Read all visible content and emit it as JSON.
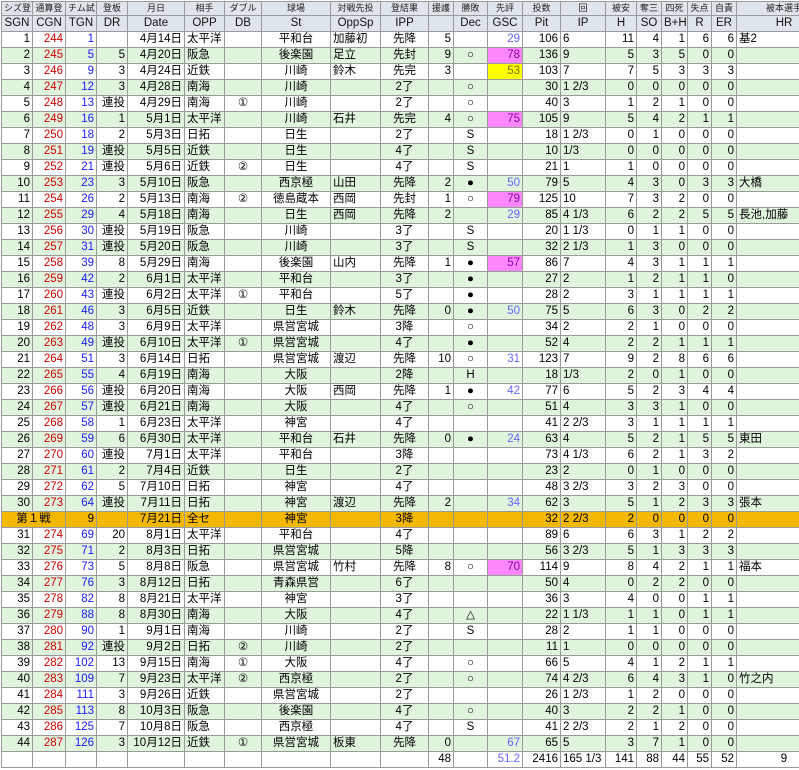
{
  "header": {
    "jp": [
      "シズ登",
      "通算登",
      "チム試",
      "登板",
      "月日",
      "相手",
      "ダブル",
      "球場",
      "対戦先投",
      "登結果",
      "援護",
      "勝敗",
      "先評",
      "投数",
      "回",
      "被安",
      "奪三",
      "四死",
      "失点",
      "自責",
      "被本選手"
    ],
    "en": [
      "SGN",
      "CGN",
      "TGN",
      "DR",
      "Date",
      "OPP",
      "DB",
      "St",
      "OppSp",
      "IPP",
      "",
      "Dec",
      "GSC",
      "Pit",
      "IP",
      "H",
      "SO",
      "B+H",
      "R",
      "ER",
      "HR"
    ]
  },
  "highlight_color": "#f5b800",
  "rows": [
    {
      "sgn": "1",
      "cgn": "244",
      "tgn": "1",
      "dr": "",
      "date": "4月14日",
      "opp": "太平洋",
      "db": "",
      "st": "平和台",
      "oppsp": "加藤初",
      "ipp": "先降",
      "run": "5",
      "dec": "",
      "gsc": "29",
      "gsc_color": "",
      "pit": "106",
      "ip": "6",
      "h": "11",
      "so": "4",
      "bh": "1",
      "r": "6",
      "er": "6",
      "hr": "基2"
    },
    {
      "sgn": "2",
      "cgn": "245",
      "tgn": "5",
      "dr": "5",
      "date": "4月20日",
      "opp": "阪急",
      "db": "",
      "st": "後楽園",
      "oppsp": "足立",
      "ipp": "先封",
      "run": "9",
      "dec": "○",
      "gsc": "78",
      "gsc_color": "pink",
      "pit": "136",
      "ip": "9",
      "h": "5",
      "so": "3",
      "bh": "5",
      "r": "0",
      "er": "0",
      "hr": ""
    },
    {
      "sgn": "3",
      "cgn": "246",
      "tgn": "9",
      "dr": "3",
      "date": "4月24日",
      "opp": "近鉄",
      "db": "",
      "st": "川崎",
      "oppsp": "鈴木",
      "ipp": "先完",
      "run": "3",
      "dec": "",
      "gsc": "53",
      "gsc_color": "yellow",
      "pit": "103",
      "ip": "7",
      "h": "7",
      "so": "5",
      "bh": "3",
      "r": "3",
      "er": "3",
      "hr": ""
    },
    {
      "sgn": "4",
      "cgn": "247",
      "tgn": "12",
      "dr": "3",
      "date": "4月28日",
      "opp": "南海",
      "db": "",
      "st": "川崎",
      "oppsp": "",
      "ipp": "2了",
      "run": "",
      "dec": "○",
      "gsc": "",
      "gsc_color": "",
      "pit": "30",
      "ip": "1 2/3",
      "h": "0",
      "so": "0",
      "bh": "0",
      "r": "0",
      "er": "0",
      "hr": ""
    },
    {
      "sgn": "5",
      "cgn": "248",
      "tgn": "13",
      "dr": "連投",
      "date": "4月29日",
      "opp": "南海",
      "db": "①",
      "st": "川崎",
      "oppsp": "",
      "ipp": "2了",
      "run": "",
      "dec": "○",
      "gsc": "",
      "gsc_color": "",
      "pit": "40",
      "ip": "3",
      "h": "1",
      "so": "2",
      "bh": "1",
      "r": "0",
      "er": "0",
      "hr": ""
    },
    {
      "sgn": "6",
      "cgn": "249",
      "tgn": "16",
      "dr": "1",
      "date": "5月1日",
      "opp": "太平洋",
      "db": "",
      "st": "川崎",
      "oppsp": "石井",
      "ipp": "先完",
      "run": "4",
      "dec": "○",
      "gsc": "75",
      "gsc_color": "pink",
      "pit": "105",
      "ip": "9",
      "h": "5",
      "so": "4",
      "bh": "2",
      "r": "1",
      "er": "1",
      "hr": ""
    },
    {
      "sgn": "7",
      "cgn": "250",
      "tgn": "18",
      "dr": "2",
      "date": "5月3日",
      "opp": "日拓",
      "db": "",
      "st": "日生",
      "oppsp": "",
      "ipp": "2了",
      "run": "",
      "dec": "S",
      "gsc": "",
      "gsc_color": "",
      "pit": "18",
      "ip": "1 2/3",
      "h": "0",
      "so": "1",
      "bh": "0",
      "r": "0",
      "er": "0",
      "hr": ""
    },
    {
      "sgn": "8",
      "cgn": "251",
      "tgn": "19",
      "dr": "連投",
      "date": "5月5日",
      "opp": "近鉄",
      "db": "",
      "st": "日生",
      "oppsp": "",
      "ipp": "4了",
      "run": "",
      "dec": "S",
      "gsc": "",
      "gsc_color": "",
      "pit": "10",
      "ip": "1/3",
      "h": "0",
      "so": "0",
      "bh": "0",
      "r": "0",
      "er": "0",
      "hr": ""
    },
    {
      "sgn": "9",
      "cgn": "252",
      "tgn": "21",
      "dr": "連投",
      "date": "5月6日",
      "opp": "近鉄",
      "db": "②",
      "st": "日生",
      "oppsp": "",
      "ipp": "4了",
      "run": "",
      "dec": "S",
      "gsc": "",
      "gsc_color": "",
      "pit": "21",
      "ip": "1",
      "h": "1",
      "so": "0",
      "bh": "0",
      "r": "0",
      "er": "0",
      "hr": ""
    },
    {
      "sgn": "10",
      "cgn": "253",
      "tgn": "23",
      "dr": "3",
      "date": "5月10日",
      "opp": "阪急",
      "db": "",
      "st": "西京極",
      "oppsp": "山田",
      "ipp": "先降",
      "run": "2",
      "dec": "●",
      "gsc": "50",
      "gsc_color": "",
      "pit": "79",
      "ip": "5",
      "h": "4",
      "so": "3",
      "bh": "0",
      "r": "3",
      "er": "3",
      "hr": "大橋"
    },
    {
      "sgn": "11",
      "cgn": "254",
      "tgn": "26",
      "dr": "2",
      "date": "5月13日",
      "opp": "南海",
      "db": "②",
      "st": "徳島蔵本",
      "oppsp": "西岡",
      "ipp": "先封",
      "run": "1",
      "dec": "○",
      "gsc": "79",
      "gsc_color": "pink",
      "pit": "125",
      "ip": "10",
      "h": "7",
      "so": "3",
      "bh": "2",
      "r": "0",
      "er": "0",
      "hr": ""
    },
    {
      "sgn": "12",
      "cgn": "255",
      "tgn": "29",
      "dr": "4",
      "date": "5月18日",
      "opp": "南海",
      "db": "",
      "st": "日生",
      "oppsp": "西岡",
      "ipp": "先降",
      "run": "2",
      "dec": "",
      "gsc": "29",
      "gsc_color": "",
      "pit": "85",
      "ip": "4 1/3",
      "h": "6",
      "so": "2",
      "bh": "2",
      "r": "5",
      "er": "5",
      "hr": "長池,加藤"
    },
    {
      "sgn": "13",
      "cgn": "256",
      "tgn": "30",
      "dr": "連投",
      "date": "5月19日",
      "opp": "阪急",
      "db": "",
      "st": "川崎",
      "oppsp": "",
      "ipp": "3了",
      "run": "",
      "dec": "S",
      "gsc": "",
      "gsc_color": "",
      "pit": "20",
      "ip": "1 1/3",
      "h": "0",
      "so": "1",
      "bh": "1",
      "r": "0",
      "er": "0",
      "hr": ""
    },
    {
      "sgn": "14",
      "cgn": "257",
      "tgn": "31",
      "dr": "連投",
      "date": "5月20日",
      "opp": "阪急",
      "db": "",
      "st": "川崎",
      "oppsp": "",
      "ipp": "3了",
      "run": "",
      "dec": "S",
      "gsc": "",
      "gsc_color": "",
      "pit": "32",
      "ip": "2 1/3",
      "h": "1",
      "so": "3",
      "bh": "0",
      "r": "0",
      "er": "0",
      "hr": ""
    },
    {
      "sgn": "15",
      "cgn": "258",
      "tgn": "39",
      "dr": "8",
      "date": "5月29日",
      "opp": "南海",
      "db": "",
      "st": "後楽園",
      "oppsp": "山内",
      "ipp": "先降",
      "run": "1",
      "dec": "●",
      "gsc": "57",
      "gsc_color": "pink",
      "pit": "86",
      "ip": "7",
      "h": "4",
      "so": "3",
      "bh": "1",
      "r": "1",
      "er": "1",
      "hr": ""
    },
    {
      "sgn": "16",
      "cgn": "259",
      "tgn": "42",
      "dr": "2",
      "date": "6月1日",
      "opp": "太平洋",
      "db": "",
      "st": "平和台",
      "oppsp": "",
      "ipp": "3了",
      "run": "",
      "dec": "●",
      "gsc": "",
      "gsc_color": "",
      "pit": "27",
      "ip": "2",
      "h": "1",
      "so": "2",
      "bh": "1",
      "r": "1",
      "er": "0",
      "hr": ""
    },
    {
      "sgn": "17",
      "cgn": "260",
      "tgn": "43",
      "dr": "連投",
      "date": "6月2日",
      "opp": "太平洋",
      "db": "①",
      "st": "平和台",
      "oppsp": "",
      "ipp": "5了",
      "run": "",
      "dec": "●",
      "gsc": "",
      "gsc_color": "",
      "pit": "28",
      "ip": "2",
      "h": "3",
      "so": "1",
      "bh": "1",
      "r": "1",
      "er": "1",
      "hr": ""
    },
    {
      "sgn": "18",
      "cgn": "261",
      "tgn": "46",
      "dr": "3",
      "date": "6月5日",
      "opp": "近鉄",
      "db": "",
      "st": "日生",
      "oppsp": "鈴木",
      "ipp": "先降",
      "run": "0",
      "dec": "●",
      "gsc": "50",
      "gsc_color": "",
      "pit": "75",
      "ip": "5",
      "h": "6",
      "so": "3",
      "bh": "0",
      "r": "2",
      "er": "2",
      "hr": ""
    },
    {
      "sgn": "19",
      "cgn": "262",
      "tgn": "48",
      "dr": "3",
      "date": "6月9日",
      "opp": "太平洋",
      "db": "",
      "st": "県営宮城",
      "oppsp": "",
      "ipp": "3降",
      "run": "",
      "dec": "○",
      "gsc": "",
      "gsc_color": "",
      "pit": "34",
      "ip": "2",
      "h": "2",
      "so": "1",
      "bh": "0",
      "r": "0",
      "er": "0",
      "hr": ""
    },
    {
      "sgn": "20",
      "cgn": "263",
      "tgn": "49",
      "dr": "連投",
      "date": "6月10日",
      "opp": "太平洋",
      "db": "①",
      "st": "県営宮城",
      "oppsp": "",
      "ipp": "4了",
      "run": "",
      "dec": "●",
      "gsc": "",
      "gsc_color": "",
      "pit": "52",
      "ip": "4",
      "h": "2",
      "so": "2",
      "bh": "1",
      "r": "1",
      "er": "1",
      "hr": ""
    },
    {
      "sgn": "21",
      "cgn": "264",
      "tgn": "51",
      "dr": "3",
      "date": "6月14日",
      "opp": "日拓",
      "db": "",
      "st": "県営宮城",
      "oppsp": "渡辺",
      "ipp": "先降",
      "run": "10",
      "dec": "○",
      "gsc": "31",
      "gsc_color": "",
      "pit": "123",
      "ip": "7",
      "h": "9",
      "so": "2",
      "bh": "8",
      "r": "6",
      "er": "6",
      "hr": ""
    },
    {
      "sgn": "22",
      "cgn": "265",
      "tgn": "55",
      "dr": "4",
      "date": "6月19日",
      "opp": "南海",
      "db": "",
      "st": "大阪",
      "oppsp": "",
      "ipp": "2降",
      "run": "",
      "dec": "H",
      "gsc": "",
      "gsc_color": "",
      "pit": "18",
      "ip": "1/3",
      "h": "2",
      "so": "0",
      "bh": "1",
      "r": "0",
      "er": "0",
      "hr": ""
    },
    {
      "sgn": "23",
      "cgn": "266",
      "tgn": "56",
      "dr": "連投",
      "date": "6月20日",
      "opp": "南海",
      "db": "",
      "st": "大阪",
      "oppsp": "西岡",
      "ipp": "先降",
      "run": "1",
      "dec": "●",
      "gsc": "42",
      "gsc_color": "",
      "pit": "77",
      "ip": "6",
      "h": "5",
      "so": "2",
      "bh": "3",
      "r": "4",
      "er": "4",
      "hr": ""
    },
    {
      "sgn": "24",
      "cgn": "267",
      "tgn": "57",
      "dr": "連投",
      "date": "6月21日",
      "opp": "南海",
      "db": "",
      "st": "大阪",
      "oppsp": "",
      "ipp": "4了",
      "run": "",
      "dec": "○",
      "gsc": "",
      "gsc_color": "",
      "pit": "51",
      "ip": "4",
      "h": "3",
      "so": "3",
      "bh": "1",
      "r": "0",
      "er": "0",
      "hr": ""
    },
    {
      "sgn": "25",
      "cgn": "268",
      "tgn": "58",
      "dr": "1",
      "date": "6月23日",
      "opp": "太平洋",
      "db": "",
      "st": "神宮",
      "oppsp": "",
      "ipp": "4了",
      "run": "",
      "dec": "",
      "gsc": "",
      "gsc_color": "",
      "pit": "41",
      "ip": "2 2/3",
      "h": "3",
      "so": "1",
      "bh": "1",
      "r": "1",
      "er": "1",
      "hr": ""
    },
    {
      "sgn": "26",
      "cgn": "269",
      "tgn": "59",
      "dr": "6",
      "date": "6月30日",
      "opp": "太平洋",
      "db": "",
      "st": "平和台",
      "oppsp": "石井",
      "ipp": "先降",
      "run": "0",
      "dec": "●",
      "gsc": "24",
      "gsc_color": "",
      "pit": "63",
      "ip": "4",
      "h": "5",
      "so": "2",
      "bh": "1",
      "r": "5",
      "er": "5",
      "hr": "東田"
    },
    {
      "sgn": "27",
      "cgn": "270",
      "tgn": "60",
      "dr": "連投",
      "date": "7月1日",
      "opp": "太平洋",
      "db": "",
      "st": "平和台",
      "oppsp": "",
      "ipp": "3降",
      "run": "",
      "dec": "",
      "gsc": "",
      "gsc_color": "",
      "pit": "73",
      "ip": "4 1/3",
      "h": "6",
      "so": "2",
      "bh": "1",
      "r": "3",
      "er": "2",
      "hr": ""
    },
    {
      "sgn": "28",
      "cgn": "271",
      "tgn": "61",
      "dr": "2",
      "date": "7月4日",
      "opp": "近鉄",
      "db": "",
      "st": "日生",
      "oppsp": "",
      "ipp": "2了",
      "run": "",
      "dec": "",
      "gsc": "",
      "gsc_color": "",
      "pit": "23",
      "ip": "2",
      "h": "0",
      "so": "1",
      "bh": "0",
      "r": "0",
      "er": "0",
      "hr": ""
    },
    {
      "sgn": "29",
      "cgn": "272",
      "tgn": "62",
      "dr": "5",
      "date": "7月10日",
      "opp": "日拓",
      "db": "",
      "st": "神宮",
      "oppsp": "",
      "ipp": "4了",
      "run": "",
      "dec": "",
      "gsc": "",
      "gsc_color": "",
      "pit": "48",
      "ip": "3 2/3",
      "h": "3",
      "so": "2",
      "bh": "3",
      "r": "0",
      "er": "0",
      "hr": ""
    },
    {
      "sgn": "30",
      "cgn": "273",
      "tgn": "64",
      "dr": "連投",
      "date": "7月11日",
      "opp": "日拓",
      "db": "",
      "st": "神宮",
      "oppsp": "渡辺",
      "ipp": "先降",
      "run": "2",
      "dec": "",
      "gsc": "34",
      "gsc_color": "",
      "pit": "62",
      "ip": "3",
      "h": "5",
      "so": "1",
      "bh": "2",
      "r": "3",
      "er": "3",
      "hr": "張本"
    },
    {
      "highlight": true,
      "label": "第１戦",
      "tgn": "9",
      "date": "7月21日",
      "opp": "全セ",
      "st": "神宮",
      "ipp": "3降",
      "pit": "32",
      "ip": "2 2/3",
      "h": "2",
      "so": "0",
      "bh": "0",
      "r": "0",
      "er": "0"
    },
    {
      "sgn": "31",
      "cgn": "274",
      "tgn": "69",
      "dr": "20",
      "date": "8月1日",
      "opp": "太平洋",
      "db": "",
      "st": "平和台",
      "oppsp": "",
      "ipp": "4了",
      "run": "",
      "dec": "",
      "gsc": "",
      "gsc_color": "",
      "pit": "89",
      "ip": "6",
      "h": "6",
      "so": "3",
      "bh": "1",
      "r": "2",
      "er": "2",
      "hr": ""
    },
    {
      "sgn": "32",
      "cgn": "275",
      "tgn": "71",
      "dr": "2",
      "date": "8月3日",
      "opp": "日拓",
      "db": "",
      "st": "県営宮城",
      "oppsp": "",
      "ipp": "5降",
      "run": "",
      "dec": "",
      "gsc": "",
      "gsc_color": "",
      "pit": "56",
      "ip": "3 2/3",
      "h": "5",
      "so": "1",
      "bh": "3",
      "r": "3",
      "er": "3",
      "hr": ""
    },
    {
      "sgn": "33",
      "cgn": "276",
      "tgn": "73",
      "dr": "5",
      "date": "8月8日",
      "opp": "阪急",
      "db": "",
      "st": "県営宮城",
      "oppsp": "竹村",
      "ipp": "先降",
      "run": "8",
      "dec": "○",
      "gsc": "70",
      "gsc_color": "pink",
      "pit": "114",
      "ip": "9",
      "h": "8",
      "so": "4",
      "bh": "2",
      "r": "1",
      "er": "1",
      "hr": "福本"
    },
    {
      "sgn": "34",
      "cgn": "277",
      "tgn": "76",
      "dr": "3",
      "date": "8月12日",
      "opp": "日拓",
      "db": "",
      "st": "青森県営",
      "oppsp": "",
      "ipp": "6了",
      "run": "",
      "dec": "",
      "gsc": "",
      "gsc_color": "",
      "pit": "50",
      "ip": "4",
      "h": "0",
      "so": "2",
      "bh": "2",
      "r": "0",
      "er": "0",
      "hr": ""
    },
    {
      "sgn": "35",
      "cgn": "278",
      "tgn": "82",
      "dr": "8",
      "date": "8月21日",
      "opp": "太平洋",
      "db": "",
      "st": "神宮",
      "oppsp": "",
      "ipp": "3了",
      "run": "",
      "dec": "",
      "gsc": "",
      "gsc_color": "",
      "pit": "36",
      "ip": "3",
      "h": "4",
      "so": "0",
      "bh": "0",
      "r": "1",
      "er": "1",
      "hr": ""
    },
    {
      "sgn": "36",
      "cgn": "279",
      "tgn": "88",
      "dr": "8",
      "date": "8月30日",
      "opp": "南海",
      "db": "",
      "st": "大阪",
      "oppsp": "",
      "ipp": "4了",
      "run": "",
      "dec": "△",
      "gsc": "",
      "gsc_color": "",
      "pit": "22",
      "ip": "1 1/3",
      "h": "1",
      "so": "1",
      "bh": "0",
      "r": "1",
      "er": "1",
      "hr": ""
    },
    {
      "sgn": "37",
      "cgn": "280",
      "tgn": "90",
      "dr": "1",
      "date": "9月1日",
      "opp": "南海",
      "db": "",
      "st": "川崎",
      "oppsp": "",
      "ipp": "2了",
      "run": "",
      "dec": "S",
      "gsc": "",
      "gsc_color": "",
      "pit": "28",
      "ip": "2",
      "h": "1",
      "so": "1",
      "bh": "0",
      "r": "0",
      "er": "0",
      "hr": ""
    },
    {
      "sgn": "38",
      "cgn": "281",
      "tgn": "92",
      "dr": "連投",
      "date": "9月2日",
      "opp": "日拓",
      "db": "②",
      "st": "川崎",
      "oppsp": "",
      "ipp": "2了",
      "run": "",
      "dec": "",
      "gsc": "",
      "gsc_color": "",
      "pit": "11",
      "ip": "1",
      "h": "0",
      "so": "0",
      "bh": "0",
      "r": "0",
      "er": "0",
      "hr": ""
    },
    {
      "sgn": "39",
      "cgn": "282",
      "tgn": "102",
      "dr": "13",
      "date": "9月15日",
      "opp": "南海",
      "db": "①",
      "st": "大阪",
      "oppsp": "",
      "ipp": "4了",
      "run": "",
      "dec": "○",
      "gsc": "",
      "gsc_color": "",
      "pit": "66",
      "ip": "5",
      "h": "4",
      "so": "1",
      "bh": "2",
      "r": "1",
      "er": "1",
      "hr": ""
    },
    {
      "sgn": "40",
      "cgn": "283",
      "tgn": "109",
      "dr": "7",
      "date": "9月23日",
      "opp": "太平洋",
      "db": "②",
      "st": "西京極",
      "oppsp": "",
      "ipp": "2了",
      "run": "",
      "dec": "○",
      "gsc": "",
      "gsc_color": "",
      "pit": "74",
      "ip": "4 2/3",
      "h": "6",
      "so": "4",
      "bh": "3",
      "r": "1",
      "er": "0",
      "hr": "竹之内"
    },
    {
      "sgn": "41",
      "cgn": "284",
      "tgn": "111",
      "dr": "3",
      "date": "9月26日",
      "opp": "近鉄",
      "db": "",
      "st": "県営宮城",
      "oppsp": "",
      "ipp": "2了",
      "run": "",
      "dec": "",
      "gsc": "",
      "gsc_color": "",
      "pit": "26",
      "ip": "1 2/3",
      "h": "1",
      "so": "2",
      "bh": "0",
      "r": "0",
      "er": "0",
      "hr": ""
    },
    {
      "sgn": "42",
      "cgn": "285",
      "tgn": "113",
      "dr": "8",
      "date": "10月3日",
      "opp": "阪急",
      "db": "",
      "st": "後楽園",
      "oppsp": "",
      "ipp": "4了",
      "run": "",
      "dec": "○",
      "gsc": "",
      "gsc_color": "",
      "pit": "40",
      "ip": "3",
      "h": "2",
      "so": "2",
      "bh": "1",
      "r": "0",
      "er": "0",
      "hr": ""
    },
    {
      "sgn": "43",
      "cgn": "286",
      "tgn": "125",
      "dr": "7",
      "date": "10月8日",
      "opp": "阪急",
      "db": "",
      "st": "西京極",
      "oppsp": "",
      "ipp": "4了",
      "run": "",
      "dec": "S",
      "gsc": "",
      "gsc_color": "",
      "pit": "41",
      "ip": "2 2/3",
      "h": "2",
      "so": "1",
      "bh": "2",
      "r": "0",
      "er": "0",
      "hr": ""
    },
    {
      "sgn": "44",
      "cgn": "287",
      "tgn": "126",
      "dr": "3",
      "date": "10月12日",
      "opp": "近鉄",
      "db": "①",
      "st": "県営宮城",
      "oppsp": "板東",
      "ipp": "先降",
      "run": "0",
      "dec": "",
      "gsc": "67",
      "gsc_color": "",
      "pit": "65",
      "ip": "5",
      "h": "3",
      "so": "7",
      "bh": "1",
      "r": "0",
      "er": "0",
      "hr": ""
    }
  ],
  "totals": {
    "run": "48",
    "gsc": "51.2",
    "pit": "2416",
    "ip": "165 1/3",
    "h": "141",
    "so": "88",
    "bh": "44",
    "r": "55",
    "er": "52",
    "hr": "9"
  }
}
